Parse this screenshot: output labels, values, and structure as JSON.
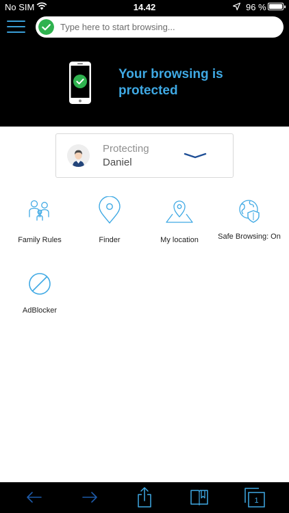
{
  "status_bar": {
    "carrier": "No SIM",
    "time": "14.42",
    "battery_percent": "96 %",
    "icons": [
      "wifi-icon",
      "location-arrow-icon",
      "battery-icon"
    ]
  },
  "top_bar": {
    "search_placeholder": "Type here to start browsing...",
    "icons": [
      "hamburger-menu-icon",
      "shield-check-icon"
    ]
  },
  "hero": {
    "title": "Your browsing is protected",
    "icon": "phone-check-icon"
  },
  "profile": {
    "status_label": "Protecting",
    "name": "Daniel",
    "icon": "chevron-down-icon"
  },
  "features": [
    {
      "label": "Family Rules",
      "icon": "family-icon"
    },
    {
      "label": "Finder",
      "icon": "map-pin-icon"
    },
    {
      "label": "My location",
      "icon": "map-location-icon"
    },
    {
      "label": "Safe Browsing: On",
      "icon": "globe-shield-icon"
    },
    {
      "label": "AdBlocker",
      "icon": "block-icon"
    }
  ],
  "toolbar": {
    "tab_count": "1",
    "icons": [
      "back-arrow-icon",
      "forward-arrow-icon",
      "share-icon",
      "bookmarks-icon",
      "tabs-icon"
    ]
  },
  "colors": {
    "accent": "#3fa9e4",
    "success": "#2fb24f",
    "header_bg": "#000000"
  }
}
